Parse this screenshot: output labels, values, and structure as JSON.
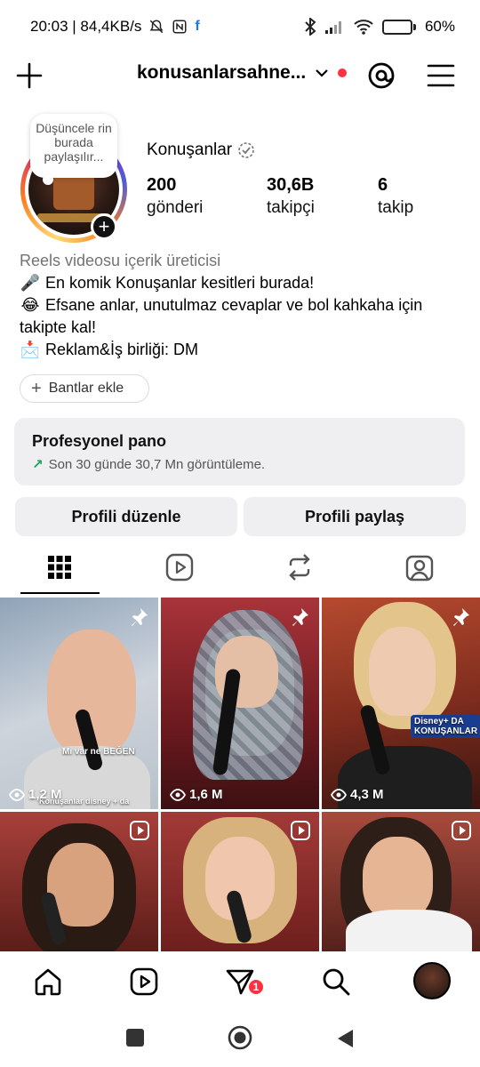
{
  "status_bar": {
    "time_network": "20:03 | 84,4KB/s",
    "battery_percent": "60",
    "battery_level": 0.6
  },
  "header": {
    "username": "konusanlarsahne..."
  },
  "profile": {
    "note": "Düşüncele rin burada paylaşılır...",
    "display_name": "Konuşanlar",
    "stats": [
      {
        "value": "200",
        "label": "gönderi"
      },
      {
        "value": "30,6B",
        "label": "takipçi"
      },
      {
        "value": "6",
        "label": "takip"
      }
    ],
    "bio": {
      "category": "Reels videosu içerik üreticisi",
      "line1": "En komik Konuşanlar kesitleri burada!",
      "line2": "Efsane anlar, unutulmaz cevaplar ve bol kahkaha için takipte kal!",
      "line3": "Reklam&İş birliği: DM"
    },
    "add_links_label": "Bantlar ekle"
  },
  "pro_dashboard": {
    "title": "Profesyonel pano",
    "subtitle": "Son 30 günde 30,7 Mn görüntüleme."
  },
  "buttons": {
    "edit": "Profili düzenle",
    "share": "Profili paylaş"
  },
  "grid": {
    "posts": [
      {
        "views": "1,2 M",
        "type": "pinned",
        "caption": "Mı var ne BEĞEN",
        "footer": "Konuşanlar disney + da"
      },
      {
        "views": "1,6 M",
        "type": "pinned"
      },
      {
        "views": "4,3 M",
        "type": "pinned",
        "logo_text": "Disney+ DA KONUŞANLAR"
      },
      {
        "views": "",
        "type": "reel"
      },
      {
        "views": "",
        "type": "reel"
      },
      {
        "views": "",
        "type": "reel"
      }
    ]
  },
  "bottom_nav": {
    "notification_count": "1"
  },
  "colors": {
    "accent_red": "#ff3040",
    "button_bg": "#efeff1",
    "secondary_text": "#737373",
    "trend_green": "#1aa35a"
  }
}
